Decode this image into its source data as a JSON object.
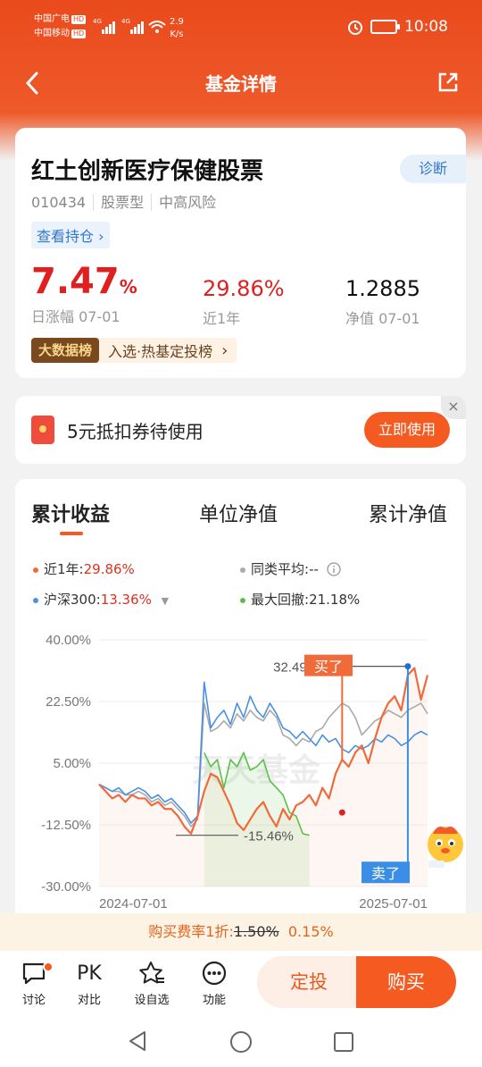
{
  "status_bar": {
    "carrier1": "中国广电",
    "carrier2": "中国移动",
    "hd": "HD",
    "sig1": "4G",
    "sig2": "4G",
    "speed_value": "2.9",
    "speed_unit": "K/s",
    "time": "10:08"
  },
  "nav": {
    "title": "基金详情"
  },
  "fund": {
    "name": "红土创新医疗保健股票",
    "diagnose_label": "诊断",
    "code": "010434",
    "type": "股票型",
    "risk": "中高风险",
    "holdings_link": "查看持仓",
    "daily_change": "7.47",
    "daily_change_unit": "%",
    "daily_change_label": "日涨幅 07-01",
    "year_return": "29.86%",
    "year_return_label": "近1年",
    "nav_value": "1.2885",
    "nav_label": "净值 07-01",
    "bigdata_tag": "大数据榜",
    "bigdata_text": "入选·热基定投榜"
  },
  "coupon": {
    "text": "5元抵扣券待使用",
    "button": "立即使用",
    "close": "×"
  },
  "chart_tabs": [
    "累计收益",
    "单位净值",
    "累计净值"
  ],
  "legend": {
    "fund_label": "近1年:",
    "fund_value": "29.86%",
    "peer_label": "同类平均:",
    "peer_value": "--",
    "index_label": "沪深300:",
    "index_value": "13.36%",
    "drawdown_label": "最大回撤:",
    "drawdown_value": "21.18%"
  },
  "chart_data": {
    "type": "line",
    "x_start": "2024-07-01",
    "x_end": "2025-07-01",
    "x_ticks": [
      "2024-07-01",
      "2025-07-01"
    ],
    "y_ticks": [
      "40.00%",
      "22.50%",
      "5.00%",
      "-12.50%",
      "-30.00%"
    ],
    "ylim": [
      -30,
      40
    ],
    "annotations": {
      "peak_value": "32.49%",
      "peak_tag": "卖了",
      "trough_value": "-15.46%",
      "sell_tag": "卖了",
      "buy_tag": "买了",
      "watermark": "天天基金"
    },
    "series": [
      {
        "name": "近1年",
        "color": "#f06a3a",
        "values": [
          -1,
          -3,
          -5,
          -4,
          -6,
          -4,
          -5,
          -5,
          -7,
          -6,
          -8,
          -8,
          -10,
          -13,
          -15,
          -10,
          -3,
          2,
          1,
          -3,
          -7,
          -12,
          -14,
          -11,
          -8,
          -6,
          -10,
          -13,
          -8,
          -11,
          -7,
          -6,
          -4,
          -7,
          -2,
          -5,
          2,
          6,
          4,
          8,
          10,
          5,
          12,
          18,
          22,
          24,
          20,
          30,
          32,
          23,
          30
        ]
      },
      {
        "name": "沪深300",
        "color": "#4a90e2",
        "values": [
          -1,
          -2,
          -3,
          -2,
          -4,
          -3,
          -2,
          -3,
          -5,
          -4,
          -6,
          -5,
          -7,
          -9,
          -12,
          -10,
          28,
          15,
          18,
          20,
          16,
          22,
          18,
          24,
          20,
          18,
          22,
          19,
          15,
          14,
          12,
          14,
          12,
          10,
          13,
          11,
          12,
          9,
          8,
          10,
          9,
          10,
          12,
          11,
          13,
          12,
          10,
          11,
          13,
          14,
          13
        ]
      },
      {
        "name": "同类平均",
        "color": "#aaaaaa",
        "values": [
          -1,
          -2,
          -3,
          -3,
          -4,
          -4,
          -3,
          -4,
          -6,
          -5,
          -7,
          -6,
          -8,
          -10,
          -13,
          -11,
          22,
          14,
          15,
          17,
          15,
          19,
          17,
          20,
          18,
          17,
          20,
          18,
          13,
          12,
          10,
          12,
          11,
          14,
          15,
          18,
          20,
          22,
          21,
          18,
          13,
          15,
          17,
          18,
          20,
          19,
          18,
          20,
          21,
          22,
          19
        ]
      },
      {
        "name": "最大回撤",
        "color": "#5cbf4a",
        "values": [
          null,
          null,
          null,
          null,
          null,
          null,
          null,
          null,
          null,
          null,
          null,
          null,
          null,
          null,
          null,
          null,
          8,
          4,
          6,
          -2,
          6,
          4,
          8,
          3,
          4,
          6,
          0,
          -2,
          -4,
          -9,
          -10,
          -15,
          -15.46,
          null,
          null,
          null,
          null,
          null,
          null,
          null,
          null,
          null,
          null,
          null,
          null,
          null,
          null,
          null,
          null,
          null,
          null
        ]
      }
    ]
  },
  "fee_bar": {
    "label": "购买费率1折:",
    "original": "1.50%",
    "discounted": "0.15%"
  },
  "bottom_bar": {
    "discuss": "讨论",
    "compare_icon": "PK",
    "compare": "对比",
    "watchlist": "设自选",
    "functions": "功能",
    "auto_invest": "定投",
    "buy": "购买"
  }
}
